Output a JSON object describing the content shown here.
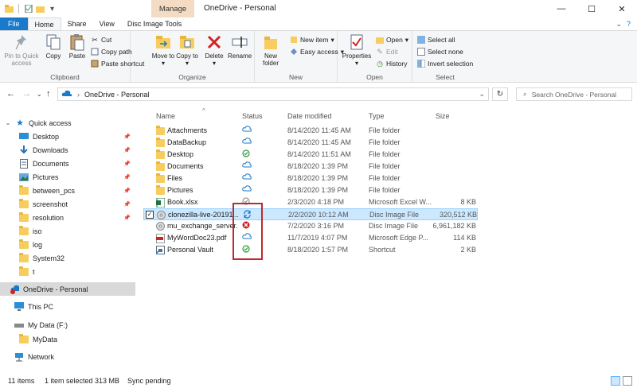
{
  "titlebar": {
    "manage_label": "Manage",
    "title": "OneDrive - Personal",
    "minimize": "—",
    "maximize": "☐",
    "close": "✕"
  },
  "tabs": {
    "file": "File",
    "home": "Home",
    "share": "Share",
    "view": "View",
    "disc_tools": "Disc Image Tools"
  },
  "ribbon": {
    "clipboard": {
      "label": "Clipboard",
      "pin": "Pin to Quick access",
      "copy": "Copy",
      "paste": "Paste",
      "cut": "Cut",
      "copy_path": "Copy path",
      "paste_shortcut": "Paste shortcut"
    },
    "organize": {
      "label": "Organize",
      "move_to": "Move to",
      "copy_to": "Copy to",
      "delete": "Delete",
      "rename": "Rename"
    },
    "new": {
      "label": "New",
      "new_folder": "New folder",
      "new_item": "New item",
      "easy_access": "Easy access"
    },
    "open": {
      "label": "Open",
      "properties": "Properties",
      "open": "Open",
      "edit": "Edit",
      "history": "History"
    },
    "select": {
      "label": "Select",
      "select_all": "Select all",
      "select_none": "Select none",
      "invert": "Invert selection"
    }
  },
  "address": {
    "path": "OneDrive - Personal",
    "search_placeholder": "Search OneDrive - Personal"
  },
  "nav": {
    "quick_access": "Quick access",
    "items": [
      {
        "label": "Desktop",
        "pinned": true
      },
      {
        "label": "Downloads",
        "pinned": true
      },
      {
        "label": "Documents",
        "pinned": true
      },
      {
        "label": "Pictures",
        "pinned": true
      },
      {
        "label": "between_pcs",
        "pinned": true
      },
      {
        "label": "screenshot",
        "pinned": true
      },
      {
        "label": "resolution",
        "pinned": true
      },
      {
        "label": "iso",
        "pinned": false
      },
      {
        "label": "log",
        "pinned": false
      },
      {
        "label": "System32",
        "pinned": false
      },
      {
        "label": "t",
        "pinned": false
      }
    ],
    "onedrive": "OneDrive - Personal",
    "this_pc": "This PC",
    "my_data": "My Data (F:)",
    "mydata_folder": "MyData",
    "network": "Network"
  },
  "columns": {
    "name": "Name",
    "status": "Status",
    "date": "Date modified",
    "type": "Type",
    "size": "Size"
  },
  "files": [
    {
      "name": "Attachments",
      "status": "cloud",
      "date": "8/14/2020 11:45 AM",
      "type": "File folder",
      "size": "",
      "icon": "folder"
    },
    {
      "name": "DataBackup",
      "status": "cloud",
      "date": "8/14/2020 11:45 AM",
      "type": "File folder",
      "size": "",
      "icon": "folder"
    },
    {
      "name": "Desktop",
      "status": "synced",
      "date": "8/14/2020 11:51 AM",
      "type": "File folder",
      "size": "",
      "icon": "folder"
    },
    {
      "name": "Documents",
      "status": "cloud",
      "date": "8/18/2020 1:39 PM",
      "type": "File folder",
      "size": "",
      "icon": "folder"
    },
    {
      "name": "Files",
      "status": "cloud",
      "date": "8/18/2020 1:39 PM",
      "type": "File folder",
      "size": "",
      "icon": "folder"
    },
    {
      "name": "Pictures",
      "status": "cloud",
      "date": "8/18/2020 1:39 PM",
      "type": "File folder",
      "size": "",
      "icon": "folder"
    },
    {
      "name": "Book.xlsx",
      "status": "synced-grey",
      "date": "2/3/2020 4:18 PM",
      "type": "Microsoft Excel W...",
      "size": "8 KB",
      "icon": "excel"
    },
    {
      "name": "clonezilla-live-20191...",
      "status": "syncing",
      "date": "2/2/2020 10:12 AM",
      "type": "Disc Image File",
      "size": "320,512 KB",
      "icon": "disc"
    },
    {
      "name": "mu_exchange_server...",
      "status": "error",
      "date": "7/2/2020 3:16 PM",
      "type": "Disc Image File",
      "size": "6,961,182 KB",
      "icon": "disc"
    },
    {
      "name": "MyWordDoc23.pdf",
      "status": "cloud",
      "date": "11/7/2019 4:07 PM",
      "type": "Microsoft Edge P...",
      "size": "114 KB",
      "icon": "pdf"
    },
    {
      "name": "Personal Vault",
      "status": "synced",
      "date": "8/18/2020 1:57 PM",
      "type": "Shortcut",
      "size": "2 KB",
      "icon": "vault"
    }
  ],
  "statusbar": {
    "count": "11 items",
    "selected": "1 item selected  313 MB",
    "sync": "Sync pending"
  },
  "colors": {
    "accent": "#1979ca",
    "manage_tab": "#f3dcc3",
    "selection": "#cce8ff",
    "highlight": "#c0272d"
  }
}
